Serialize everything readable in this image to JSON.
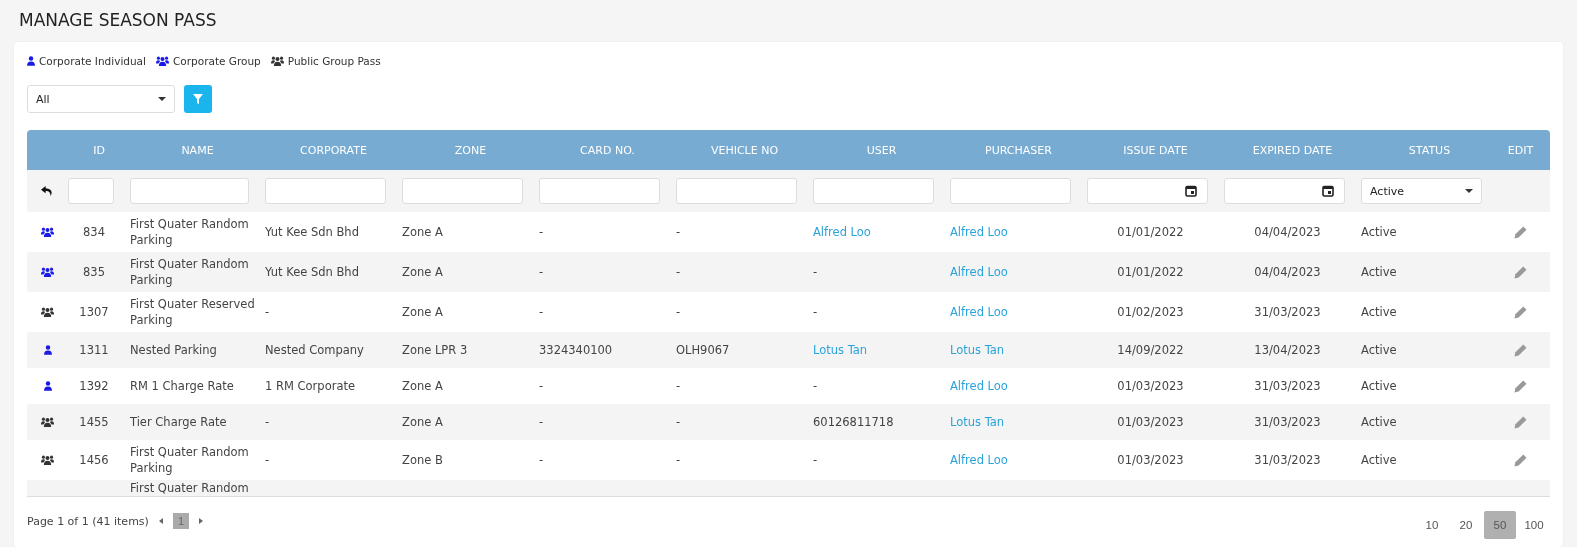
{
  "page_title": "MANAGE SEASON PASS",
  "legend": [
    {
      "kind": "corporate_individual",
      "label": "Corporate Individual"
    },
    {
      "kind": "corporate_group",
      "label": "Corporate Group"
    },
    {
      "kind": "public_group",
      "label": "Public Group Pass"
    }
  ],
  "type_filter": {
    "value": "All"
  },
  "table": {
    "columns": [
      "ID",
      "NAME",
      "CORPORATE",
      "ZONE",
      "CARD NO.",
      "VEHICLE NO",
      "USER",
      "PURCHASER",
      "ISSUE DATE",
      "EXPIRED DATE",
      "STATUS",
      "EDIT"
    ],
    "filters": [
      {
        "kind": "text"
      },
      {
        "kind": "text"
      },
      {
        "kind": "text"
      },
      {
        "kind": "text"
      },
      {
        "kind": "text"
      },
      {
        "kind": "text"
      },
      {
        "kind": "text"
      },
      {
        "kind": "text"
      },
      {
        "kind": "date"
      },
      {
        "kind": "date"
      },
      {
        "kind": "select",
        "value": "Active"
      }
    ],
    "rows": [
      {
        "kind": "corporate_group",
        "id": "834",
        "name": "First Quater Random Parking",
        "corporate": "Yut Kee Sdn Bhd",
        "zone": "Zone A",
        "card_no": "-",
        "vehicle_no": "-",
        "user": {
          "text": "Alfred Loo",
          "link": true
        },
        "purchaser": {
          "text": "Alfred Loo",
          "link": true
        },
        "issue_date": "01/01/2022",
        "expired_date": "04/04/2023",
        "status": "Active"
      },
      {
        "kind": "corporate_group",
        "id": "835",
        "name": "First Quater Random Parking",
        "corporate": "Yut Kee Sdn Bhd",
        "zone": "Zone A",
        "card_no": "-",
        "vehicle_no": "-",
        "user": {
          "text": "-",
          "link": false
        },
        "purchaser": {
          "text": "Alfred Loo",
          "link": true
        },
        "issue_date": "01/01/2022",
        "expired_date": "04/04/2023",
        "status": "Active"
      },
      {
        "kind": "public_group",
        "id": "1307",
        "name": "First Quater Reserved Parking",
        "corporate": "-",
        "zone": "Zone A",
        "card_no": "-",
        "vehicle_no": "-",
        "user": {
          "text": "-",
          "link": false
        },
        "purchaser": {
          "text": "Alfred Loo",
          "link": true
        },
        "issue_date": "01/02/2023",
        "expired_date": "31/03/2023",
        "status": "Active"
      },
      {
        "kind": "corporate_individual",
        "id": "1311",
        "name": "Nested Parking",
        "corporate": "Nested Company",
        "zone": "Zone LPR 3",
        "card_no": "3324340100",
        "vehicle_no": "OLH9067",
        "user": {
          "text": "Lotus Tan",
          "link": true
        },
        "purchaser": {
          "text": "Lotus Tan",
          "link": true
        },
        "issue_date": "14/09/2022",
        "expired_date": "13/04/2023",
        "status": "Active"
      },
      {
        "kind": "corporate_individual",
        "id": "1392",
        "name": "RM 1 Charge Rate",
        "corporate": "1 RM Corporate",
        "zone": "Zone A",
        "card_no": "-",
        "vehicle_no": "-",
        "user": {
          "text": "-",
          "link": false
        },
        "purchaser": {
          "text": "Alfred Loo",
          "link": true
        },
        "issue_date": "01/03/2023",
        "expired_date": "31/03/2023",
        "status": "Active"
      },
      {
        "kind": "public_group",
        "id": "1455",
        "name": "Tier Charge Rate",
        "corporate": "-",
        "zone": "Zone A",
        "card_no": "-",
        "vehicle_no": "-",
        "user": {
          "text": "60126811718",
          "link": false
        },
        "purchaser": {
          "text": "Lotus Tan",
          "link": true
        },
        "issue_date": "01/03/2023",
        "expired_date": "31/03/2023",
        "status": "Active"
      },
      {
        "kind": "public_group",
        "id": "1456",
        "name": "First Quater Random Parking",
        "corporate": "-",
        "zone": "Zone B",
        "card_no": "-",
        "vehicle_no": "-",
        "user": {
          "text": "-",
          "link": false
        },
        "purchaser": {
          "text": "Alfred Loo",
          "link": true
        },
        "issue_date": "01/03/2023",
        "expired_date": "31/03/2023",
        "status": "Active"
      }
    ],
    "partial_row": {
      "name": "First Quater Random"
    }
  },
  "pager": {
    "summary": "Page 1 of 1 (41 items)",
    "pages": [
      {
        "label": "1",
        "selected": true
      }
    ],
    "page_sizes": [
      {
        "label": "10",
        "selected": false
      },
      {
        "label": "20",
        "selected": false
      },
      {
        "label": "50",
        "selected": true
      },
      {
        "label": "100",
        "selected": false
      }
    ]
  }
}
